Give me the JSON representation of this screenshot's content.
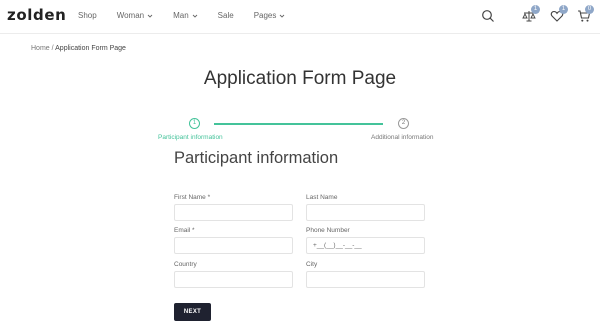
{
  "header": {
    "logo": "zolden",
    "nav": [
      {
        "label": "Shop",
        "has_dropdown": false
      },
      {
        "label": "Woman",
        "has_dropdown": true
      },
      {
        "label": "Man",
        "has_dropdown": true
      },
      {
        "label": "Sale",
        "has_dropdown": false
      },
      {
        "label": "Pages",
        "has_dropdown": true
      }
    ],
    "icons": {
      "search": "search-icon",
      "compare": {
        "icon": "compare-icon",
        "count": "1"
      },
      "wishlist": {
        "icon": "heart-icon",
        "count": "1"
      },
      "cart": {
        "icon": "cart-icon",
        "count": "0"
      }
    }
  },
  "breadcrumb": {
    "home": "Home",
    "separator": " / ",
    "current": "Application Form Page"
  },
  "page_title": "Application Form Page",
  "steps": [
    {
      "number": "1",
      "label": "Participant information",
      "active": true
    },
    {
      "number": "2",
      "label": "Additional information",
      "active": false
    }
  ],
  "section_title": "Participant information",
  "form": {
    "first_name_label": "First Name *",
    "last_name_label": "Last Name",
    "email_label": "Email *",
    "phone_label": "Phone Number",
    "phone_value": "+__(__)__-__-__",
    "country_label": "Country",
    "city_label": "City",
    "next_label": "NEXT"
  },
  "colors": {
    "accent": "#44c39a",
    "button": "#1f2230",
    "badge": "#8fa7c8"
  }
}
